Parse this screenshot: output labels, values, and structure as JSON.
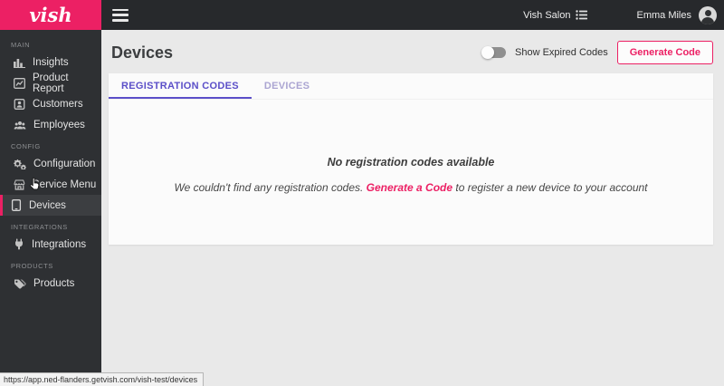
{
  "colors": {
    "brand_pink": "#EC2064",
    "active_tab_purple": "#5B4FC8",
    "inactive_tab_purple": "#ABA5D2",
    "sidebar_bg": "#2e3033",
    "topbar_bg": "#27292c",
    "main_bg": "#e9e9e9"
  },
  "topbar": {
    "logo_text": "vish",
    "salon_name": "Vish Salon",
    "user_name": "Emma Miles",
    "icons": {
      "menu": "hamburger-icon",
      "salon_switcher": "list-icon",
      "avatar": "person-avatar-icon"
    }
  },
  "sidebar": {
    "sections": [
      {
        "label": "MAIN",
        "items": [
          {
            "label": "Insights",
            "icon": "bar-chart-icon"
          },
          {
            "label": "Product Report",
            "icon": "report-chart-icon"
          },
          {
            "label": "Customers",
            "icon": "contact-card-icon"
          },
          {
            "label": "Employees",
            "icon": "people-icon"
          }
        ]
      },
      {
        "label": "CONFIG",
        "items": [
          {
            "label": "Configuration",
            "icon": "gears-icon"
          },
          {
            "label": "Service Menu",
            "icon": "storefront-icon"
          },
          {
            "label": "Devices",
            "icon": "tablet-icon",
            "active": true
          }
        ]
      },
      {
        "label": "INTEGRATIONS",
        "items": [
          {
            "label": "Integrations",
            "icon": "plug-icon"
          }
        ]
      },
      {
        "label": "PRODUCTS",
        "items": [
          {
            "label": "Products",
            "icon": "tags-icon"
          }
        ]
      }
    ]
  },
  "page": {
    "title": "Devices",
    "toggle_label": "Show Expired Codes",
    "toggle_state": "off",
    "generate_button_label": "Generate Code"
  },
  "tabs": [
    {
      "label": "REGISTRATION CODES",
      "active": true
    },
    {
      "label": "DEVICES",
      "active": false
    }
  ],
  "empty_state": {
    "title": "No registration codes available",
    "message_prefix": "We couldn't find any registration codes. ",
    "link_label": "Generate a Code",
    "message_suffix": " to register a new device to your account"
  },
  "statusbar": {
    "url": "https://app.ned-flanders.getvish.com/vish-test/devices"
  }
}
